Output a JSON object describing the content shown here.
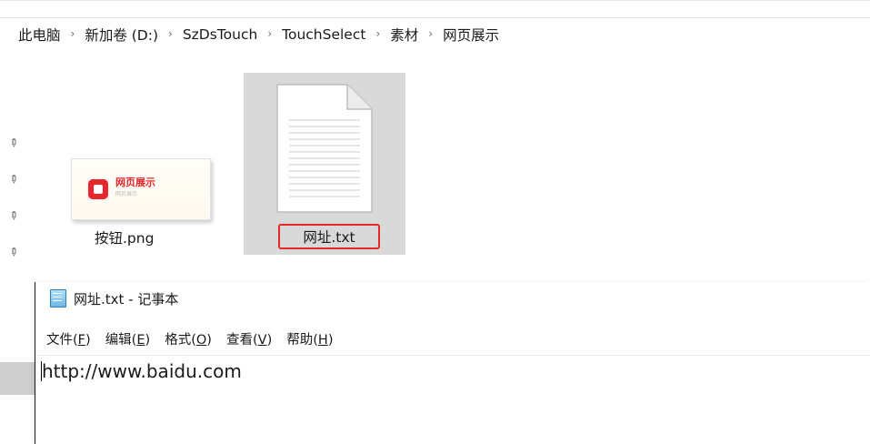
{
  "breadcrumb": {
    "items": [
      "此电脑",
      "新加卷 (D:)",
      "SzDsTouch",
      "TouchSelect",
      "素材",
      "网页展示"
    ],
    "separator": "›"
  },
  "files": [
    {
      "name": "按钮.png",
      "icon": "png-thumbnail",
      "thumbnail_title": "网页展示",
      "thumbnail_subtitle": "网页展示"
    },
    {
      "name": "网址.txt",
      "icon": "text-document-icon",
      "selected": true,
      "highlight_color": "#e32a2a"
    }
  ],
  "notepad": {
    "title": "网址.txt - 记事本",
    "menu": [
      {
        "label": "文件(",
        "key": "F",
        "end": ")"
      },
      {
        "label": "编辑(",
        "key": "E",
        "end": ")"
      },
      {
        "label": "格式(",
        "key": "O",
        "end": ")"
      },
      {
        "label": "查看(",
        "key": "V",
        "end": ")"
      },
      {
        "label": "帮助(",
        "key": "H",
        "end": ")"
      }
    ],
    "content": "http://www.baidu.com"
  },
  "colors": {
    "accent_red": "#e32a2a",
    "selection_gray": "#d9d9d9"
  }
}
